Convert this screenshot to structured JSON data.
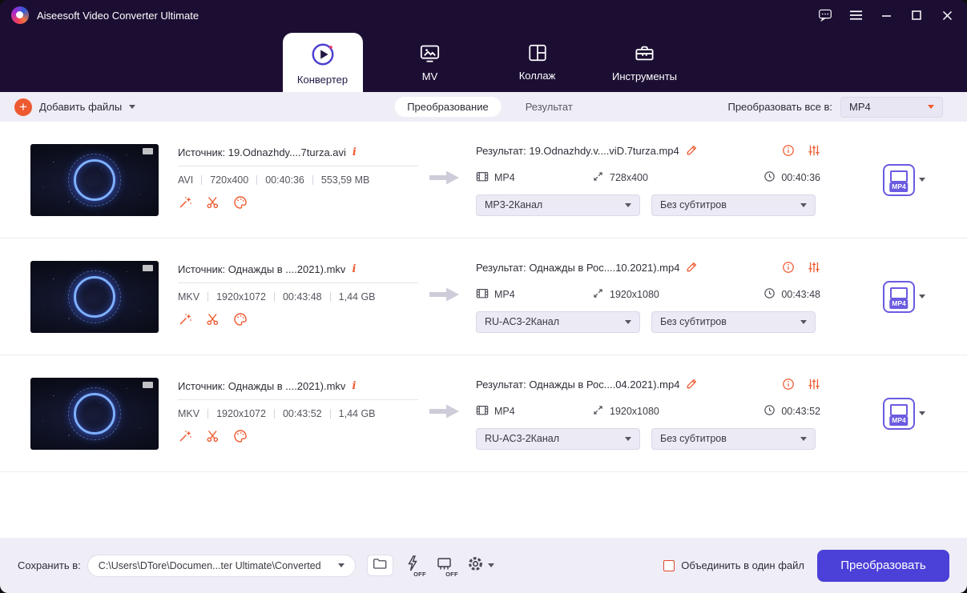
{
  "titlebar": {
    "app_title": "Aiseesoft Video Converter Ultimate"
  },
  "nav": {
    "tabs": [
      {
        "label": "Конвертер"
      },
      {
        "label": "MV"
      },
      {
        "label": "Коллаж"
      },
      {
        "label": "Инструменты"
      }
    ]
  },
  "toolbar": {
    "add_files_label": "Добавить файлы",
    "view_tabs": [
      {
        "label": "Преобразование"
      },
      {
        "label": "Результат"
      }
    ],
    "convert_all_label": "Преобразовать все в:",
    "convert_all_value": "MP4"
  },
  "icons": {
    "info_letter": "i"
  },
  "files": [
    {
      "source": "Источник: 19.Odnazhdy....7turza.avi",
      "format": "AVI",
      "resolution": "720x400",
      "duration": "00:40:36",
      "size": "553,59 MB",
      "result": "Результат: 19.Odnazhdy.v....viD.7turza.mp4",
      "out_format": "MP4",
      "out_resolution": "728x400",
      "out_duration": "00:40:36",
      "audio_track": "MP3-2Канал",
      "subtitle_track": "Без субтитров",
      "output_badge": "MP4"
    },
    {
      "source": "Источник: Однажды в ....2021).mkv",
      "format": "MKV",
      "resolution": "1920x1072",
      "duration": "00:43:48",
      "size": "1,44 GB",
      "result": "Результат: Однажды в Рос....10.2021).mp4",
      "out_format": "MP4",
      "out_resolution": "1920x1080",
      "out_duration": "00:43:48",
      "audio_track": "RU-AC3-2Канал",
      "subtitle_track": "Без субтитров",
      "output_badge": "MP4"
    },
    {
      "source": "Источник: Однажды в ....2021).mkv",
      "format": "MKV",
      "resolution": "1920x1072",
      "duration": "00:43:52",
      "size": "1,44 GB",
      "result": "Результат: Однажды в Рос....04.2021).mp4",
      "out_format": "MP4",
      "out_resolution": "1920x1080",
      "out_duration": "00:43:52",
      "audio_track": "RU-AC3-2Канал",
      "subtitle_track": "Без субтитров",
      "output_badge": "MP4"
    }
  ],
  "footer": {
    "save_label": "Сохранить в:",
    "save_path": "C:\\Users\\DTore\\Documen...ter Ultimate\\Converted",
    "lightning_off": "OFF",
    "gpu_off": "OFF",
    "merge_label": "Объединить в один файл",
    "convert_button": "Преобразовать"
  }
}
